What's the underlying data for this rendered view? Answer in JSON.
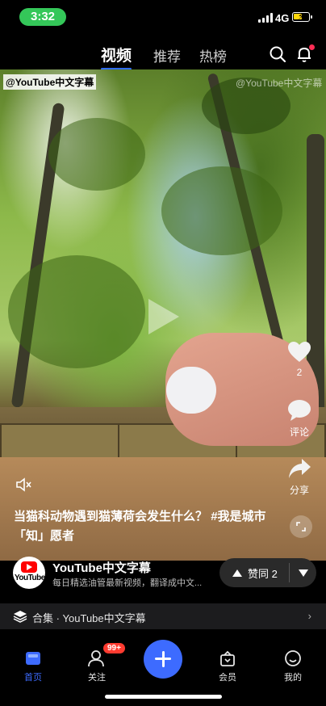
{
  "status_bar": {
    "time": "3:32",
    "network": "4G"
  },
  "top_nav": {
    "tabs": [
      {
        "label": "视频",
        "active": true
      },
      {
        "label": "推荐"
      },
      {
        "label": "热榜"
      }
    ]
  },
  "video": {
    "watermark": "@YouTube中文字幕",
    "watermark_faint": "@YouTube中文字幕",
    "caption": "当猫科动物遇到猫薄荷会发生什么？",
    "hashtag": "#我是城市「知」愿者",
    "like_count": "2",
    "comment_label": "评论",
    "share_label": "分享"
  },
  "author": {
    "avatar_text": "YouTube",
    "name": "YouTube中文字幕",
    "description": "每日精选油管最新视频，翻译成中文...",
    "upvote_label": "赞同 2"
  },
  "collection": {
    "label": "合集 · YouTube中文字幕"
  },
  "tab_bar": {
    "items": [
      {
        "label": "首页",
        "active": true
      },
      {
        "label": "关注",
        "badge": "99+"
      },
      {
        "label": "会员"
      },
      {
        "label": "我的"
      }
    ]
  },
  "colors": {
    "accent": "#3d6bff",
    "status_green": "#34c759",
    "badge_red": "#ff3b30"
  }
}
